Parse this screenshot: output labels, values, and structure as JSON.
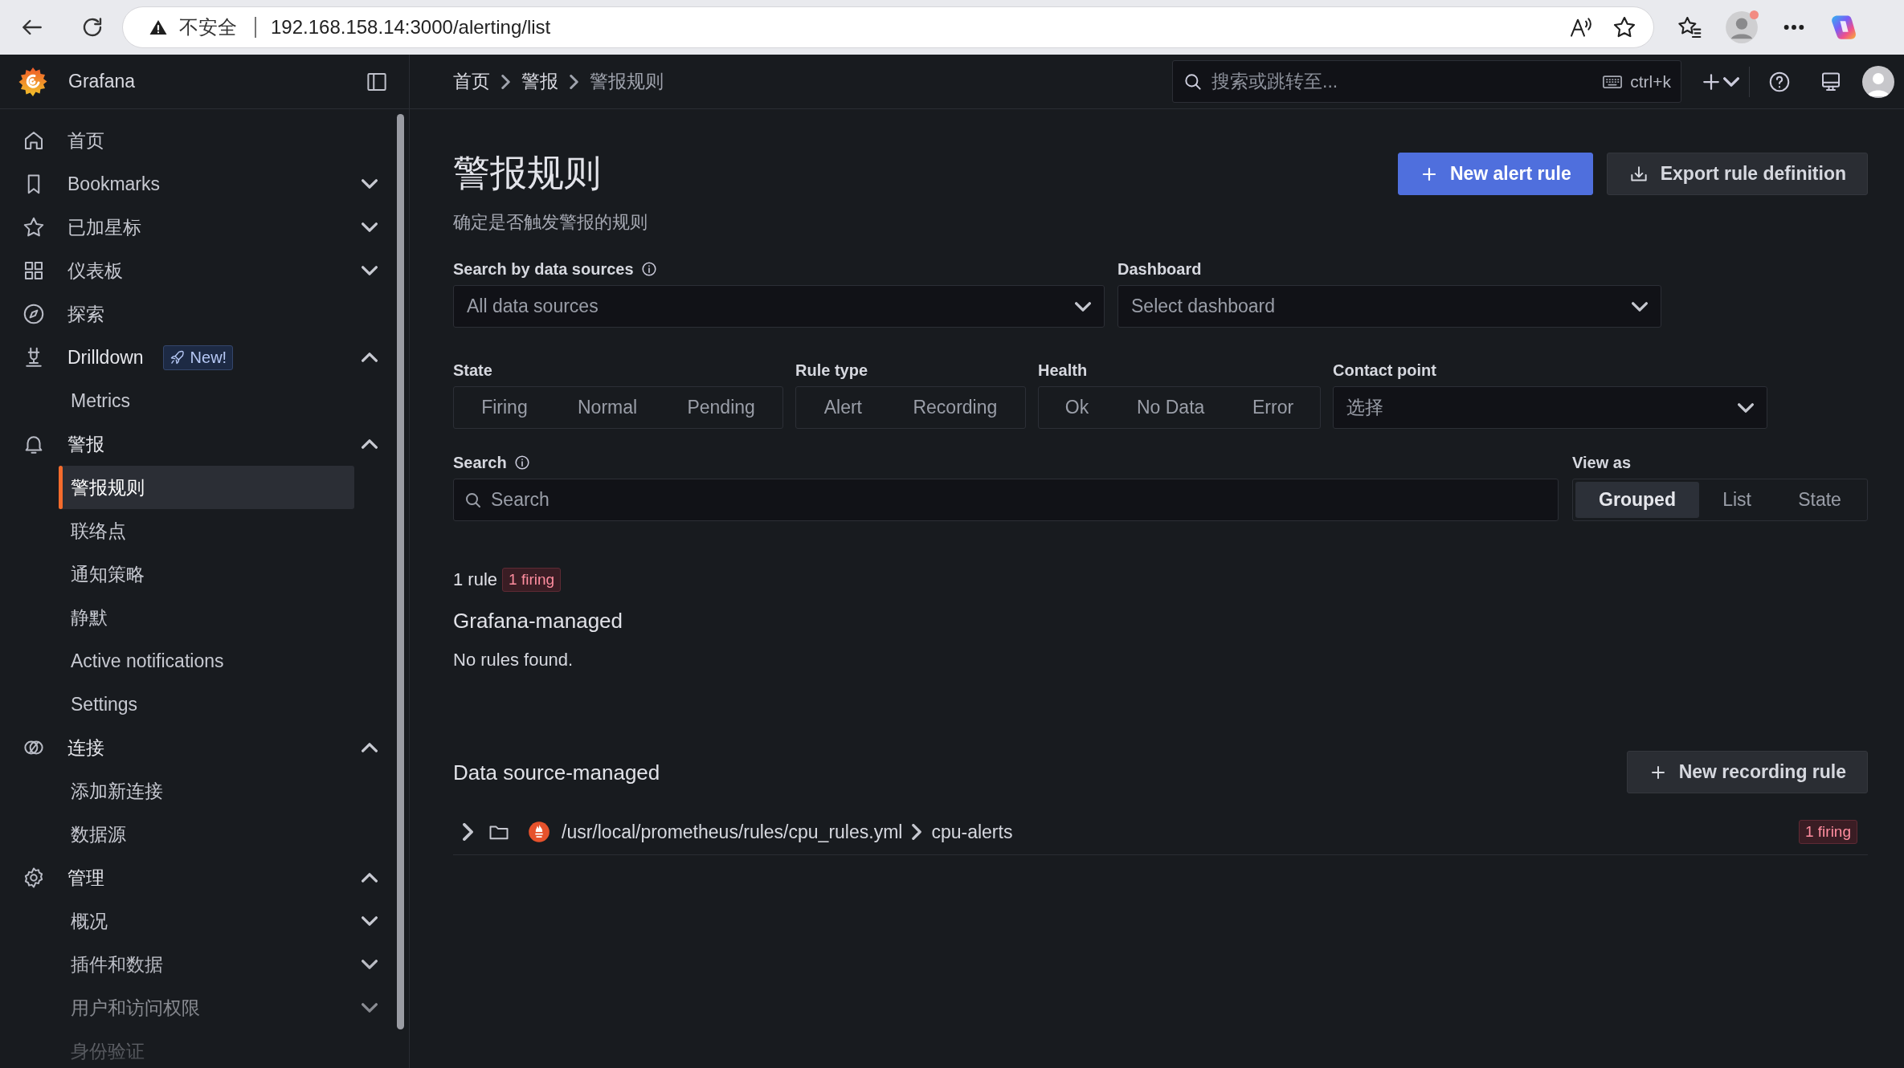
{
  "browser": {
    "security_label": "不安全",
    "url": "192.168.158.14:3000/alerting/list"
  },
  "app": {
    "name": "Grafana"
  },
  "breadcrumbs": [
    {
      "label": "首页",
      "current": false
    },
    {
      "label": "警报",
      "current": false
    },
    {
      "label": "警报规则",
      "current": true
    }
  ],
  "search": {
    "placeholder": "搜索或跳转至...",
    "shortcut": "ctrl+k"
  },
  "sidebar": {
    "items": [
      {
        "label": "首页",
        "kind": "link",
        "selected": false
      },
      {
        "label": "Bookmarks",
        "kind": "group",
        "expanded": false,
        "selected": false
      },
      {
        "label": "已加星标",
        "kind": "group",
        "expanded": false,
        "selected": false
      },
      {
        "label": "仪表板",
        "kind": "group",
        "expanded": false,
        "selected": false
      },
      {
        "label": "探索",
        "kind": "link",
        "selected": false
      },
      {
        "label": "Drilldown",
        "kind": "group",
        "expanded": true,
        "selected": false,
        "badge": "New!",
        "children": [
          {
            "label": "Metrics",
            "kind": "link",
            "selected": false
          }
        ]
      },
      {
        "label": "警报",
        "kind": "group",
        "expanded": true,
        "selected": false,
        "children": [
          {
            "label": "警报规则",
            "kind": "link",
            "selected": true
          },
          {
            "label": "联络点",
            "kind": "link",
            "selected": false
          },
          {
            "label": "通知策略",
            "kind": "link",
            "selected": false
          },
          {
            "label": "静默",
            "kind": "link",
            "selected": false
          },
          {
            "label": "Active notifications",
            "kind": "link",
            "selected": false
          },
          {
            "label": "Settings",
            "kind": "link",
            "selected": false
          }
        ]
      },
      {
        "label": "连接",
        "kind": "group",
        "expanded": true,
        "selected": false,
        "children": [
          {
            "label": "添加新连接",
            "kind": "link",
            "selected": false
          },
          {
            "label": "数据源",
            "kind": "link",
            "selected": false
          }
        ]
      },
      {
        "label": "管理",
        "kind": "group",
        "expanded": true,
        "selected": false,
        "children": [
          {
            "label": "概况",
            "kind": "group",
            "expanded": false,
            "selected": false
          },
          {
            "label": "插件和数据",
            "kind": "group",
            "expanded": false,
            "selected": false
          },
          {
            "label": "用户和访问权限",
            "kind": "group",
            "expanded": false,
            "selected": false
          },
          {
            "label": "身份验证",
            "kind": "link",
            "selected": false
          }
        ]
      }
    ]
  },
  "page": {
    "title": "警报规则",
    "subtitle": "确定是否触发警报的规则"
  },
  "actions": [
    {
      "label": "New alert rule",
      "kind": "primary"
    },
    {
      "label": "Export rule definition",
      "kind": "secondary"
    }
  ],
  "selects": [
    {
      "label": "Search by data sources",
      "info": true,
      "placeholder": "All data sources"
    },
    {
      "label": "Dashboard",
      "info": false,
      "placeholder": "Select dashboard"
    }
  ],
  "toggle_filters": [
    {
      "label": "State",
      "options": [
        {
          "label": "Firing",
          "selected": false
        },
        {
          "label": "Normal",
          "selected": false
        },
        {
          "label": "Pending",
          "selected": false
        }
      ]
    },
    {
      "label": "Rule type",
      "options": [
        {
          "label": "Alert",
          "selected": false
        },
        {
          "label": "Recording",
          "selected": false
        }
      ]
    },
    {
      "label": "Health",
      "options": [
        {
          "label": "Ok",
          "selected": false
        },
        {
          "label": "No Data",
          "selected": false
        },
        {
          "label": "Error",
          "selected": false
        }
      ]
    }
  ],
  "contact_point": {
    "label": "Contact point",
    "placeholder": "选择"
  },
  "search_field": {
    "label": "Search",
    "info": true,
    "placeholder": "Search"
  },
  "view_as": {
    "label": "View as",
    "options": [
      {
        "label": "Grouped",
        "selected": true
      },
      {
        "label": "List",
        "selected": false
      },
      {
        "label": "State",
        "selected": false
      }
    ]
  },
  "summary": {
    "count": "1 rule",
    "badge": "1 firing"
  },
  "grafana_managed": {
    "title": "Grafana-managed",
    "empty_text": "No rules found."
  },
  "datasource_managed": {
    "title": "Data source-managed",
    "action": "New recording rule",
    "rows": [
      {
        "expanded": false,
        "path": "/usr/local/prometheus/rules/cpu_rules.yml",
        "group": "cpu-alerts",
        "badge": "1 firing"
      }
    ]
  }
}
